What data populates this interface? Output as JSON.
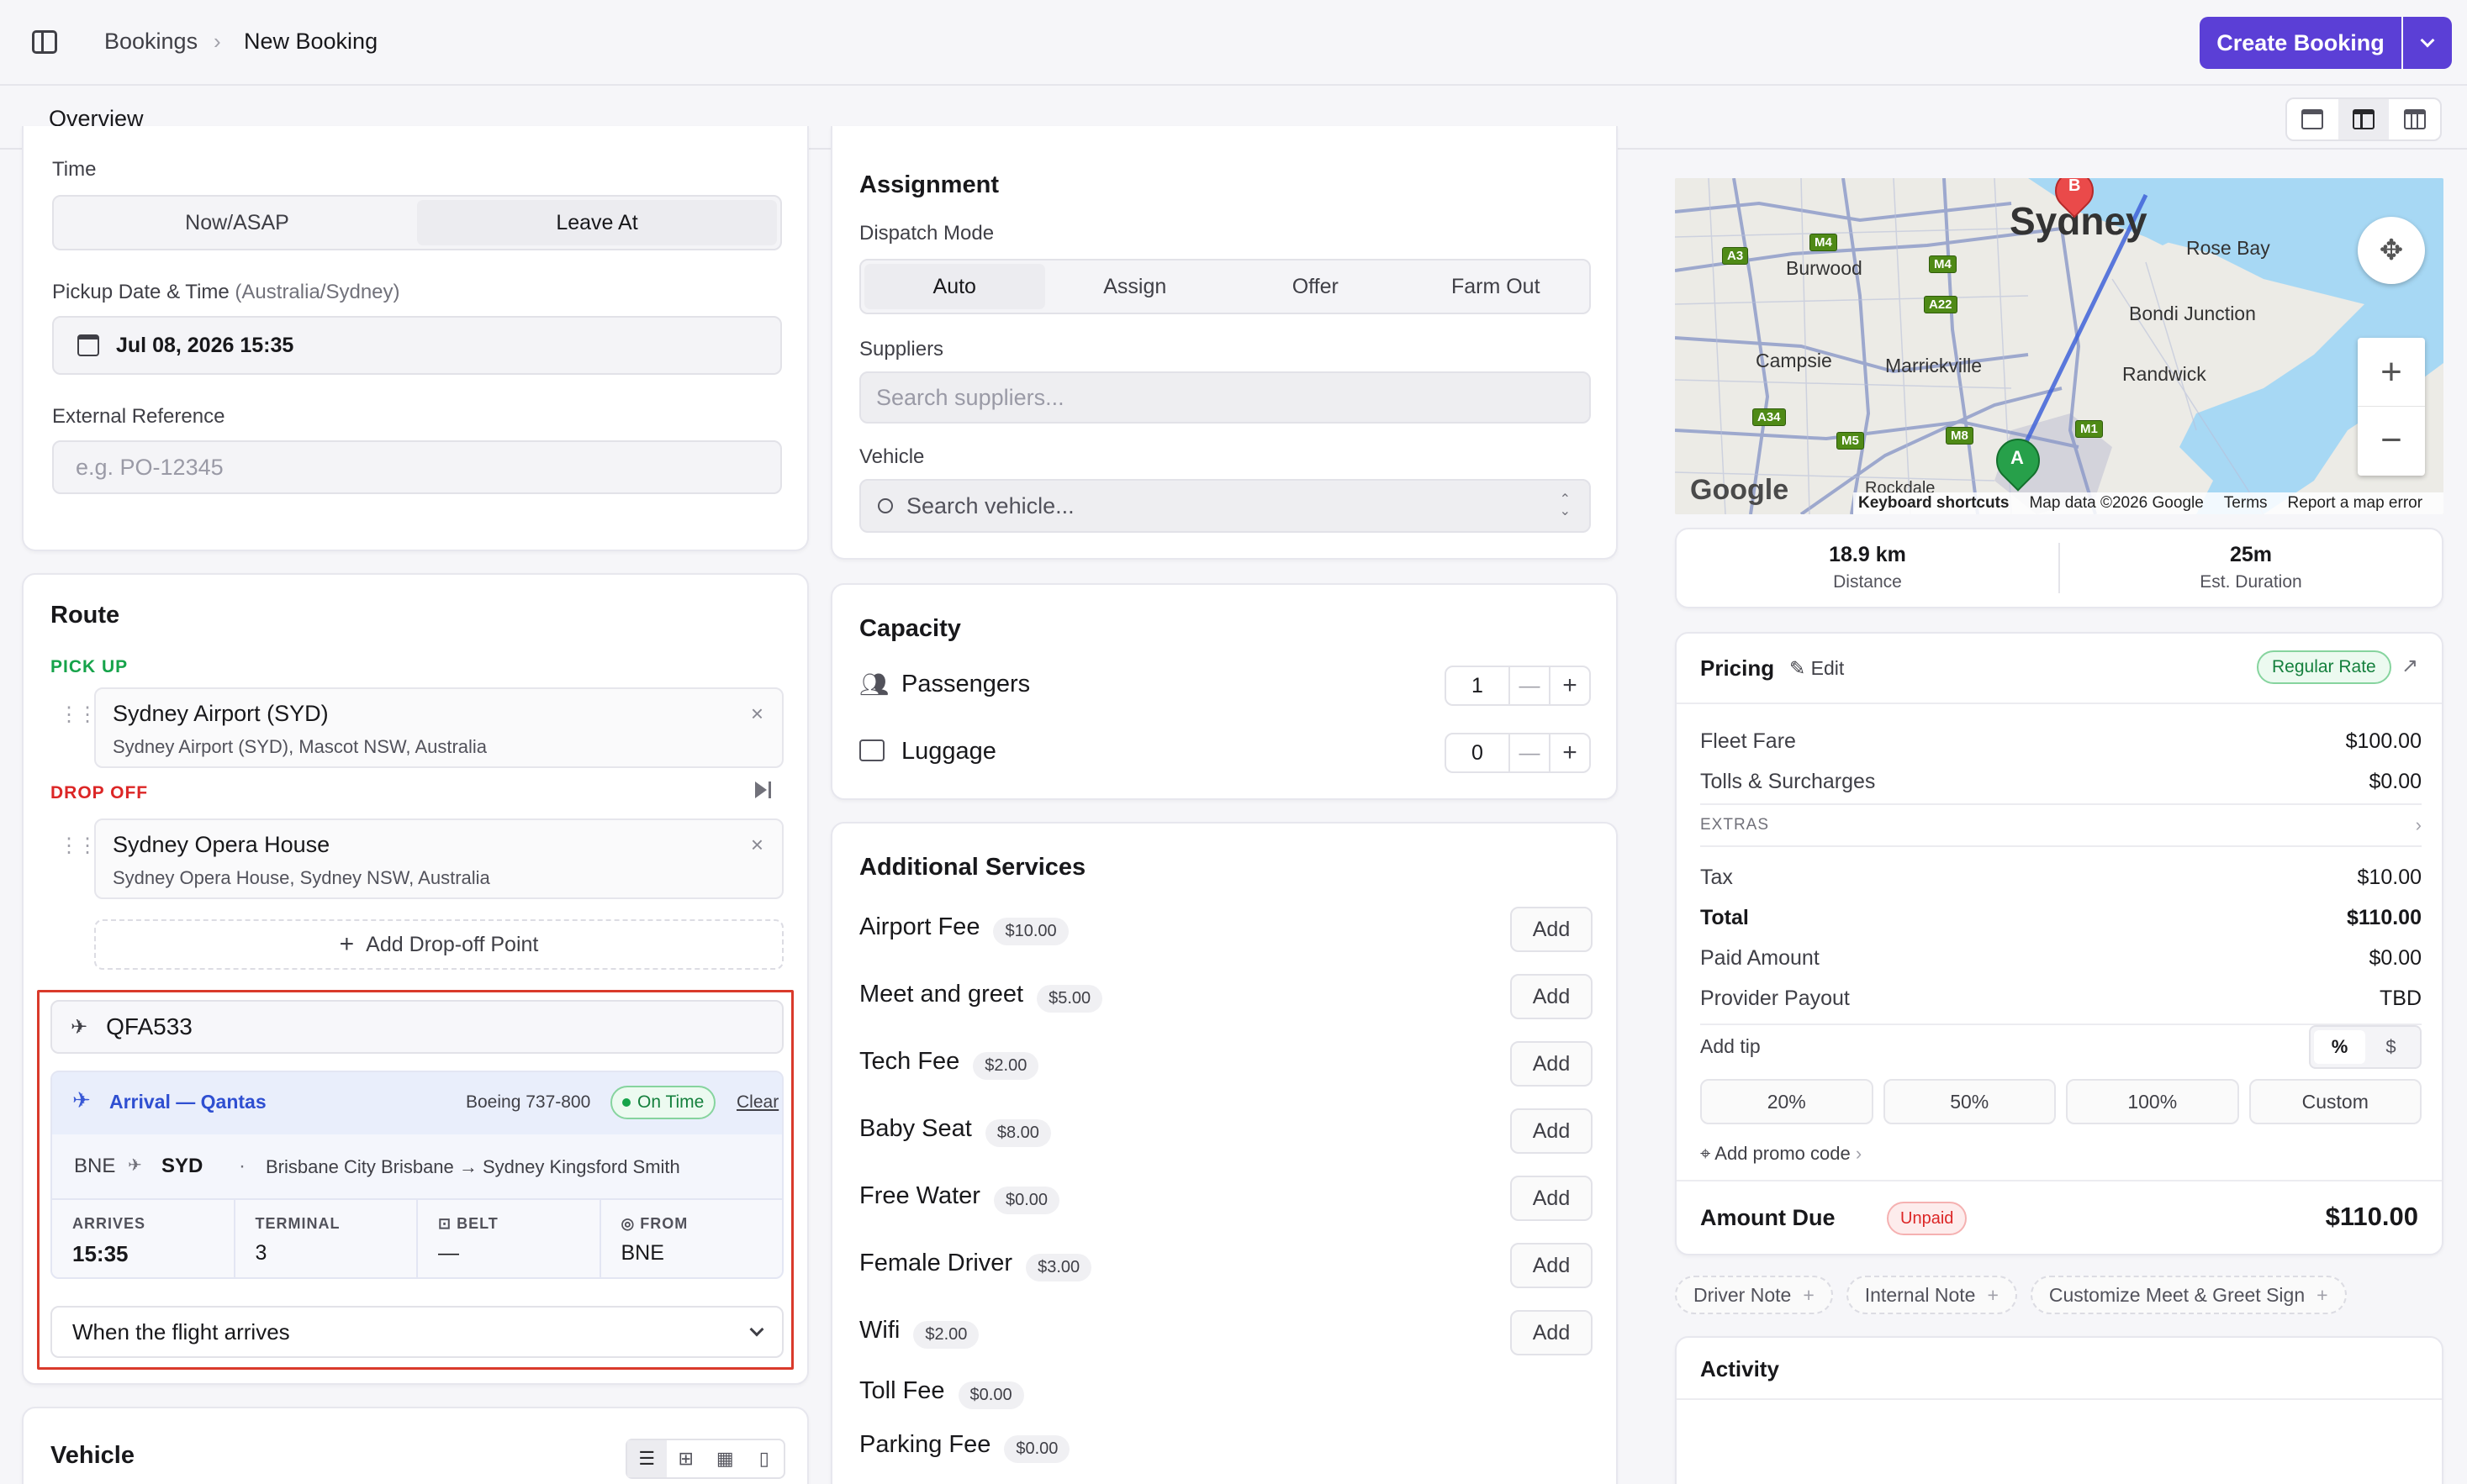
{
  "header": {
    "breadcrumb": [
      "Bookings",
      "New Booking"
    ],
    "primary_button": "Create Booking"
  },
  "tabs": [
    "Overview"
  ],
  "time": {
    "label": "Time",
    "options": [
      "Now/ASAP",
      "Leave At"
    ],
    "selected": "Leave At",
    "pickup_label": "Pickup Date & Time",
    "pickup_tz": "(Australia/Sydney)",
    "pickup_value": "Jul 08, 2026 15:35",
    "ext_ref_label": "External Reference",
    "ext_ref_placeholder": "e.g. PO-12345"
  },
  "route": {
    "title": "Route",
    "pickup_label": "PICK UP",
    "pickup_name": "Sydney Airport (SYD)",
    "pickup_addr": "Sydney Airport (SYD), Mascot NSW, Australia",
    "dropoff_label": "DROP OFF",
    "dropoff_name": "Sydney Opera House",
    "dropoff_addr": "Sydney Opera House, Sydney NSW, Australia",
    "add_dropoff": "Add Drop-off Point"
  },
  "flight": {
    "number": "QFA533",
    "title": "Arrival — Qantas",
    "aircraft": "Boeing 737-800",
    "status": "On Time",
    "clear": "Clear",
    "from_code": "BNE",
    "to_code": "SYD",
    "dot": "·",
    "route_desc": "Brisbane City Brisbane → Sydney Kingsford Smith",
    "arrives_label": "ARRIVES",
    "arrives_value": "15:35",
    "terminal_label": "TERMINAL",
    "terminal_value": "3",
    "belt_label": "BELT",
    "belt_value": "—",
    "from_label": "FROM",
    "from_value": "BNE",
    "pickup_when": "When the flight arrives"
  },
  "vehicle_section": {
    "title": "Vehicle"
  },
  "assignment": {
    "title": "Assignment",
    "dispatch_label": "Dispatch Mode",
    "modes": [
      "Auto",
      "Assign",
      "Offer",
      "Farm Out"
    ],
    "selected": "Auto",
    "suppliers_label": "Suppliers",
    "suppliers_placeholder": "Search suppliers...",
    "vehicle_label": "Vehicle",
    "vehicle_placeholder": "Search vehicle..."
  },
  "capacity": {
    "title": "Capacity",
    "passengers_label": "Passengers",
    "passengers": "1",
    "luggage_label": "Luggage",
    "luggage": "0"
  },
  "services": {
    "title": "Additional Services",
    "add_label": "Add",
    "items": [
      {
        "name": "Airport Fee",
        "price": "$10.00",
        "addable": true
      },
      {
        "name": "Meet and greet",
        "price": "$5.00",
        "addable": true
      },
      {
        "name": "Tech Fee",
        "price": "$2.00",
        "addable": true
      },
      {
        "name": "Baby Seat",
        "price": "$8.00",
        "addable": true
      },
      {
        "name": "Free Water",
        "price": "$0.00",
        "addable": true
      },
      {
        "name": "Female Driver",
        "price": "$3.00",
        "addable": true
      },
      {
        "name": "Wifi",
        "price": "$2.00",
        "addable": true
      },
      {
        "name": "Toll Fee",
        "price": "$0.00",
        "addable": false
      },
      {
        "name": "Parking Fee",
        "price": "$0.00",
        "addable": false
      }
    ]
  },
  "map": {
    "city": "Sydney",
    "places": [
      "Burwood",
      "Rose Bay",
      "Bondi Junction",
      "Campsie",
      "Marrickville",
      "Randwick",
      "Rockdale"
    ],
    "roads": [
      "M4",
      "M4",
      "A3",
      "A22",
      "A34",
      "M5",
      "M8",
      "M1"
    ],
    "marker_a": "A",
    "marker_b": "B",
    "attribution": [
      "Keyboard shortcuts",
      "Map data ©2026 Google",
      "Terms",
      "Report a map error"
    ],
    "logo": "Google",
    "distance": "18.9 km",
    "distance_label": "Distance",
    "duration": "25m",
    "duration_label": "Est. Duration"
  },
  "pricing": {
    "title": "Pricing",
    "edit": "Edit",
    "rate_badge": "Regular Rate",
    "rows": [
      {
        "label": "Fleet Fare",
        "value": "$100.00"
      },
      {
        "label": "Tolls & Surcharges",
        "value": "$0.00"
      }
    ],
    "extras_label": "EXTRAS",
    "tax_label": "Tax",
    "tax": "$10.00",
    "total_label": "Total",
    "total": "$110.00",
    "paid_label": "Paid Amount",
    "paid": "$0.00",
    "payout_label": "Provider Payout",
    "payout": "TBD",
    "tip_label": "Add tip",
    "tip_modes": [
      "%",
      "$"
    ],
    "tips": [
      "20%",
      "50%",
      "100%",
      "Custom"
    ],
    "promo": "Add promo code",
    "amount_due_label": "Amount Due",
    "amount_due_status": "Unpaid",
    "amount_due": "$110.00"
  },
  "notes": [
    "Driver Note",
    "Internal Note",
    "Customize Meet & Greet Sign"
  ],
  "activity": {
    "title": "Activity"
  },
  "colors": {
    "accent": "#5b3fd6",
    "highlight": "#d93a2b",
    "green": "#16a34a"
  }
}
